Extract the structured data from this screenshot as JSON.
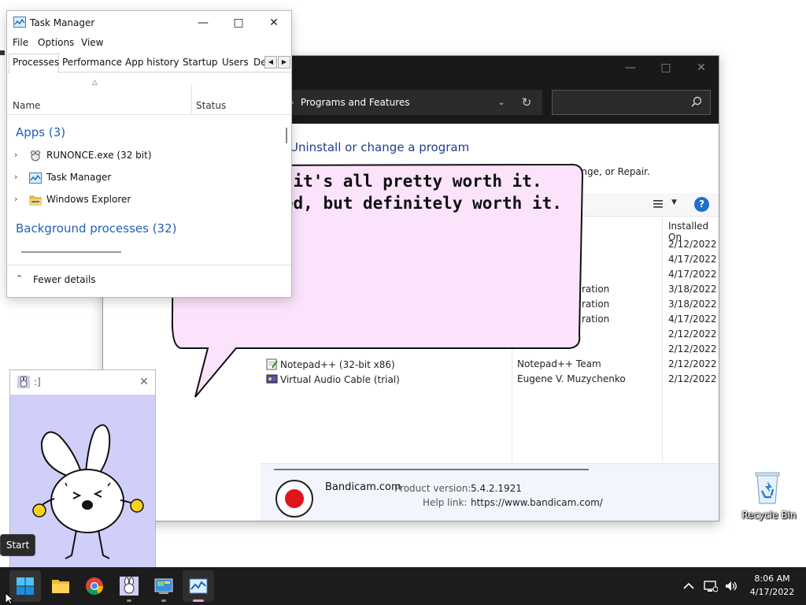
{
  "programs_features": {
    "breadcrumb": "Programs and Features",
    "heading": "Uninstall or change a program",
    "subtext": "ange, or Repair.",
    "columns": {
      "installed_on": "Installed On"
    },
    "rows": [
      {
        "name": "",
        "publisher": "",
        "installed_on": "2/12/2022"
      },
      {
        "name": "",
        "publisher": "",
        "installed_on": "4/17/2022"
      },
      {
        "name": "",
        "publisher": "",
        "installed_on": "4/17/2022"
      },
      {
        "name": "",
        "publisher": "ration",
        "installed_on": "3/18/2022"
      },
      {
        "name": "",
        "publisher": "ration",
        "installed_on": "3/18/2022"
      },
      {
        "name": "",
        "publisher": "ration",
        "installed_on": "4/17/2022"
      },
      {
        "name": "",
        "publisher": "",
        "installed_on": "2/12/2022"
      },
      {
        "name": "",
        "publisher": "",
        "installed_on": "2/12/2022"
      },
      {
        "name": "Notepad++ (32-bit x86)",
        "publisher": "Notepad++ Team",
        "installed_on": "2/12/2022"
      },
      {
        "name": "Virtual Audio Cable (trial)",
        "publisher": "Eugene V. Muzychenko",
        "installed_on": "2/12/2022"
      }
    ],
    "details": {
      "publisher": "Bandicam.com",
      "product_version_label": "Product version:",
      "product_version": "5.4.2.1921",
      "help_link_label": "Help link:",
      "help_link": "https://www.bandicam.com/"
    }
  },
  "speech_bubble": {
    "line1": "I think it's all pretty worth it.",
    "line2": "Complicated, but definitely worth it."
  },
  "task_manager": {
    "title": "Task Manager",
    "menu": [
      "File",
      "Options",
      "View"
    ],
    "tabs": [
      "Processes",
      "Performance",
      "App history",
      "Startup",
      "Users",
      "De"
    ],
    "columns": {
      "name": "Name",
      "status": "Status"
    },
    "apps_group": "Apps (3)",
    "apps": [
      "RUNONCE.exe (32 bit)",
      "Task Manager",
      "Windows Explorer"
    ],
    "background_group": "Background processes (32)",
    "fewer_details": "Fewer details"
  },
  "bunny_window": {
    "title": ":]"
  },
  "desktop": {
    "recycle_bin": "Recycle Bin",
    "start_tooltip": "Start"
  },
  "taskbar": {
    "time": "8:06 AM",
    "date": "4/17/2022"
  },
  "colors": {
    "taskbar": "#1c1c1c",
    "bubble_fill": "#fbe3fb",
    "bunny_bg": "#cfcffa",
    "link_blue": "#2560b8",
    "accent": "#e8a0d0"
  },
  "icons": [
    "windows-start-icon",
    "file-explorer-icon",
    "chrome-icon",
    "bunny-app-icon",
    "control-panel-icon",
    "task-manager-icon",
    "chevron-up-icon",
    "network-icon",
    "volume-icon",
    "recycle-bin-icon",
    "search-icon",
    "help-icon",
    "view-options-icon",
    "refresh-icon",
    "close-icon",
    "minimize-icon",
    "maximize-icon"
  ]
}
